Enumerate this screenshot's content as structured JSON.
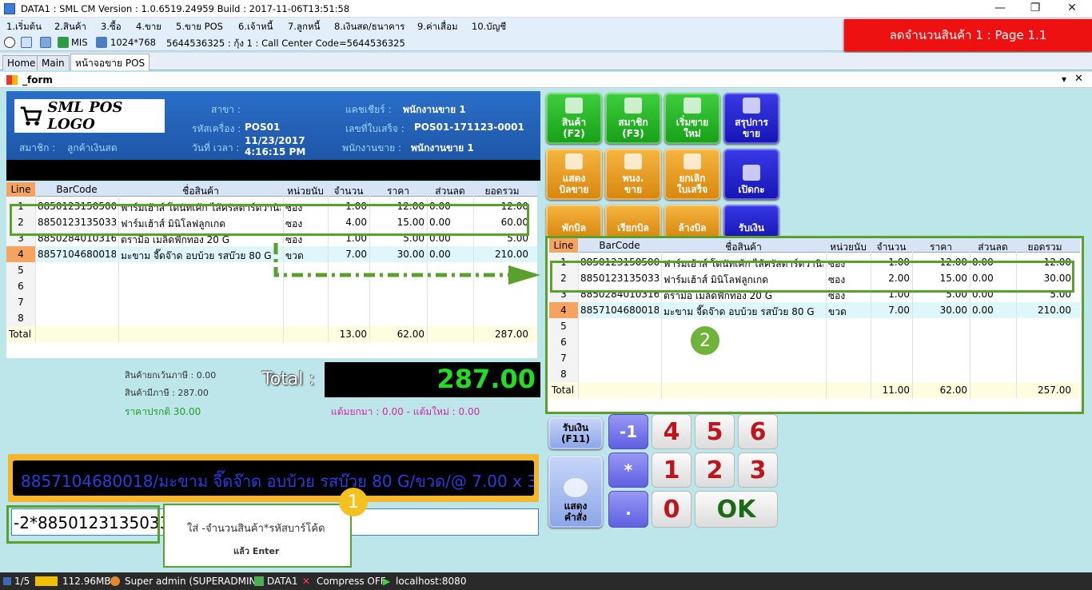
{
  "titlebar": {
    "title": "DATA1 : SML CM Version : 1.0.6519.24959  Build : 2017-11-06T13:51:58",
    "minimize": "—",
    "restore": "❐",
    "close": "✕"
  },
  "menu": [
    "1.เริ่มต้น",
    "2.สินค้า",
    "3.ซื้อ",
    "4.ขาย",
    "5.ขาย POS",
    "6.เจ้าหนี้",
    "7.ลูกหนี้",
    "8.เงินสด/ธนาคาร",
    "9.ค่าเสื่อม",
    "10.บัญชี"
  ],
  "toolbar": {
    "mis": "MIS",
    "resolution": "1024*768",
    "info": "5644536325 : กุ้ง 1 : Call Center Code=5644536325"
  },
  "banner": "ลดจำนวนสินค้า 1 : Page 1.1",
  "tabs": [
    "Home",
    "Main",
    "หน้าจอขาย POS"
  ],
  "form": {
    "title": "_form",
    "pin": "▾",
    "close": "✕"
  },
  "header": {
    "logo": "SML POS LOGO",
    "branch_label": "สาขา :",
    "branch_value": "",
    "machine_label": "รหัสเครื่อง :",
    "machine_value": "POS01",
    "datetime_label": "วันที่ เวลา :",
    "date_value": "11/23/2017",
    "time_value": "4:16:15 PM",
    "member_label": "สมาชิก :",
    "member_value": "ลูกค้าเงินสด",
    "cashier_label": "แคชเชียร์ :",
    "cashier_value": "พนักงานขาย 1",
    "receipt_label": "เลขที่ใบเสร็จ :",
    "receipt_value": "POS01-171123-0001",
    "seller_label": "พนักงานขาย :",
    "seller_value": "พนักงานขาย 1"
  },
  "columns": [
    "Line",
    "BarCode",
    "ชื่อสินค้า",
    "หน่วยนับ",
    "จำนวน",
    "ราคา",
    "ส่วนลด",
    "ยอดรวม"
  ],
  "grid1": {
    "rows": [
      {
        "line": "1",
        "barcode": "8850123150500",
        "name": "ฟาร์มเฮ้าส์ โดนัทเค้ก ไส้ครัสตาร์ดวานิล...",
        "unit": "ซอง",
        "qty": "1.00",
        "price": "12.00",
        "disc": "0.00",
        "total": "12.00"
      },
      {
        "line": "2",
        "barcode": "8850123135033",
        "name": "ฟาร์มเฮ้าส์ มินิโลฟลูกเกด",
        "unit": "ซอง",
        "qty": "4.00",
        "price": "15.00",
        "disc": "0.00",
        "total": "60.00"
      },
      {
        "line": "3",
        "barcode": "8850284010316",
        "name": "ตรามือ เมล็ดฟักทอง 20 G",
        "unit": "ซอง",
        "qty": "1.00",
        "price": "5.00",
        "disc": "0.00",
        "total": "5.00"
      },
      {
        "line": "4",
        "barcode": "8857104680018",
        "name": "มะขาม จี๊ดจ๊าด อบบ้วย รสบ๊วย 80 G",
        "unit": "ขวด",
        "qty": "7.00",
        "price": "30.00",
        "disc": "0.00",
        "total": "210.00"
      },
      {
        "line": "5"
      },
      {
        "line": "6"
      },
      {
        "line": "7"
      },
      {
        "line": "8"
      }
    ],
    "total": {
      "label": "Total",
      "qty": "13.00",
      "price": "62.00",
      "total": "287.00"
    }
  },
  "grid2": {
    "rows": [
      {
        "line": "1",
        "barcode": "8850123150500",
        "name": "ฟาร์มเฮ้าส์ โดนัทเค้ก ไส้ครัสตาร์ดวานิล...",
        "unit": "ซอง",
        "qty": "1.00",
        "price": "12.00",
        "disc": "0.00",
        "total": "12.00"
      },
      {
        "line": "2",
        "barcode": "8850123135033",
        "name": "ฟาร์มเฮ้าส์ มินิโลฟลูกเกด",
        "unit": "ซอง",
        "qty": "2.00",
        "price": "15.00",
        "disc": "0.00",
        "total": "30.00"
      },
      {
        "line": "3",
        "barcode": "8850284010316",
        "name": "ตรามือ เมล็ดฟักทอง 20 G",
        "unit": "ซอง",
        "qty": "1.00",
        "price": "5.00",
        "disc": "0.00",
        "total": "5.00"
      },
      {
        "line": "4",
        "barcode": "8857104680018",
        "name": "มะขาม จี๊ดจ๊าด อบบ้วย รสบ๊วย 80 G",
        "unit": "ขวด",
        "qty": "7.00",
        "price": "30.00",
        "disc": "0.00",
        "total": "210.00"
      },
      {
        "line": "5"
      },
      {
        "line": "6"
      },
      {
        "line": "7"
      },
      {
        "line": "8"
      }
    ],
    "total": {
      "label": "Total",
      "qty": "11.00",
      "price": "62.00",
      "total": "257.00"
    }
  },
  "summary": {
    "exempt": "สินค้ายกเว้นภาษี : 0.00",
    "vat": "สินค้ามีภาษี : 287.00",
    "normal_price": "ราคาปรกติ 30.00",
    "total_label": "Total :",
    "total_value": "287.00",
    "points": "แต้มยกมา : 0.00 - แต้มใหม่ : 0.00"
  },
  "marquee": "8857104680018/มะขาม จี๊ดจ๊าด อบบ้วย รสบ๊วย 80 G/ขวด/@ 7.00 x 3",
  "input": {
    "value": "-2*8850123135033"
  },
  "callout": {
    "badge": "1",
    "line1": "ใส่ -จำนวนสินค้า*รหัสบาร์โค้ด",
    "line2": "แล้ว Enter"
  },
  "badge2": "2",
  "buttons": {
    "product": "สินค้า\n(F2)",
    "member": "สมาชิก\n(F3)",
    "newsale": "เริ่มขาย\nใหม่",
    "salesum": "สรุปการ\nขาย",
    "showbill": "แสดง\nบิลขาย",
    "staff": "พนง.\nขาย",
    "cancel": "ยกเลิก\nใบเสร็จ",
    "drawer": "เปิดกะ",
    "holdbill": "พักบิล",
    "recallbill": "เรียกบิล",
    "clearbill": "ล้างบิล",
    "pay": "รับเงิน",
    "pay_f11": "รับเงิน\n(F11)",
    "showcmd": "แสดง\nคำสั่ง"
  },
  "keys": {
    "minus1": "-1",
    "star": "*",
    "dot": ".",
    "k4": "4",
    "k5": "5",
    "k6": "6",
    "k1": "1",
    "k2": "2",
    "k3": "3",
    "k0": "0",
    "ok": "OK"
  },
  "status": {
    "page": "1/5",
    "memory": "112.96MB",
    "user": "Super admin (SUPERADMIN)",
    "db": "DATA1",
    "compress": "Compress OFF",
    "server": "localhost:8080"
  },
  "colors": {
    "accent_green": "#5aa02c",
    "banner_red": "#ee1111",
    "total_green": "#22dd22"
  }
}
